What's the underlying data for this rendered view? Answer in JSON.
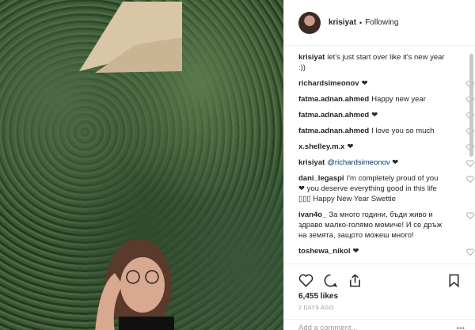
{
  "header": {
    "username": "krisiyat",
    "separator": "•",
    "follow_label": "Following"
  },
  "comments": [
    {
      "user": "krisiyat",
      "text": "let's just start over like it's new year :))",
      "heart": false
    },
    {
      "user": "richardsimeonov",
      "text": "❤",
      "heart": true
    },
    {
      "user": "fatma.adnan.ahmed",
      "text": "Happy new year",
      "heart": true
    },
    {
      "user": "fatma.adnan.ahmed",
      "text": "❤",
      "heart": true
    },
    {
      "user": "fatma.adnan.ahmed",
      "text": "I love you so much",
      "heart": true
    },
    {
      "user": "x.shelley.m.x",
      "text": "❤",
      "heart": true
    },
    {
      "user": "krisiyat",
      "mention": "@richardsimeonov",
      "text": "❤",
      "heart": true
    },
    {
      "user": "dani_legaspi",
      "text": "I'm completely proud of you ❤ you deserve everything good in this life ▯▯▯ Happy New Year Swettie",
      "heart": true
    },
    {
      "user": "ivan4o_",
      "text": "За много години, бъди живо и здраво малко-голямо момиче! И се дръж на земята, защото можеш много!",
      "heart": true
    },
    {
      "user": "toshewa_nikol",
      "text": "❤",
      "heart": true
    }
  ],
  "likes": "6,455 likes",
  "time_ago": "2 DAYS AGO",
  "add_comment_placeholder": "Add a comment...",
  "more_label": "•••"
}
